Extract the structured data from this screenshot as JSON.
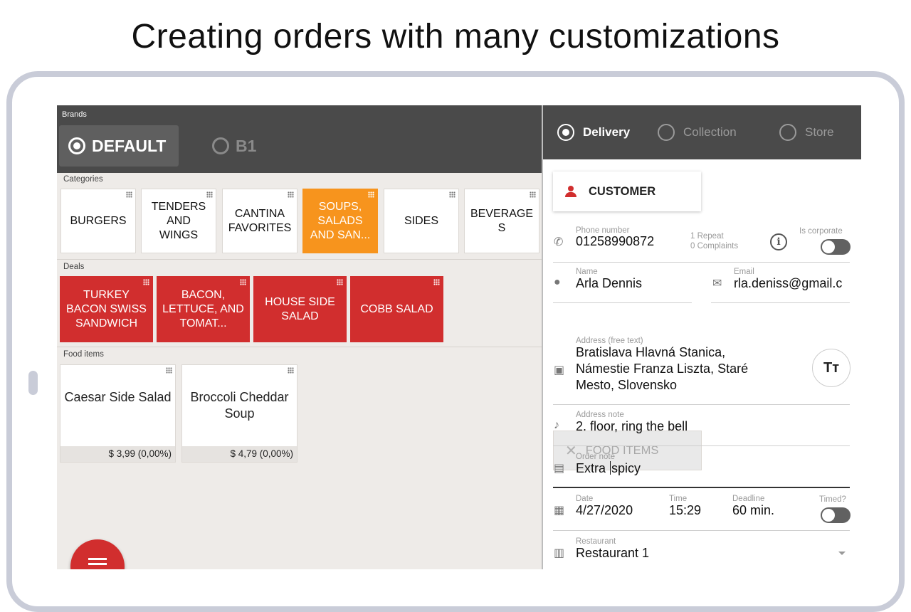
{
  "headline": "Creating orders with many customizations",
  "brands": {
    "label": "Brands",
    "items": [
      {
        "label": "DEFAULT",
        "selected": true
      },
      {
        "label": "B1",
        "selected": false
      }
    ]
  },
  "categories": {
    "label": "Categories",
    "items": [
      "BURGERS",
      "TENDERS AND WINGS",
      "CANTINA FAVORITES",
      "SOUPS, SALADS AND SAN...",
      "SIDES",
      "BEVERAGE S"
    ],
    "selected_index": 3
  },
  "deals": {
    "label": "Deals",
    "items": [
      "TURKEY BACON SWISS SANDWICH",
      "BACON, LETTUCE, AND TOMAT...",
      "HOUSE SIDE SALAD",
      "COBB SALAD"
    ]
  },
  "food_items": {
    "label": "Food items",
    "items": [
      {
        "name": "Caesar Side Salad",
        "price": "$ 3,99 (0,00%)"
      },
      {
        "name": "Broccoli Cheddar Soup",
        "price": "$ 4,79 (0,00%)"
      }
    ]
  },
  "delivery_types": [
    {
      "label": "Delivery",
      "selected": true
    },
    {
      "label": "Collection",
      "selected": false
    },
    {
      "label": "Store",
      "selected": false
    }
  ],
  "tabs": {
    "customer": "CUSTOMER",
    "food_items": "FOOD ITEMS"
  },
  "form": {
    "phone": {
      "label": "Phone number",
      "value": "01258990872"
    },
    "repeat": "1 Repeat",
    "complaints": "0 Complaints",
    "corporate": {
      "label": "Is corporate",
      "on": false
    },
    "name": {
      "label": "Name",
      "value": "Arla Dennis"
    },
    "email": {
      "label": "Email",
      "value": "rla.deniss@gmail.c"
    },
    "address": {
      "label": "Address (free text)",
      "line1": "Bratislava Hlavná Stanica,",
      "line2": "Námestie Franza Liszta, Staré",
      "line3": "Mesto, Slovensko"
    },
    "text_format_button": "Tт",
    "address_note": {
      "label": "Address note",
      "value": "2. floor, ring the bell"
    },
    "order_note": {
      "label": "Order note",
      "value_before_cursor": "Extra ",
      "value_after_cursor": "spicy"
    },
    "date": {
      "label": "Date",
      "value": "4/27/2020"
    },
    "time": {
      "label": "Time",
      "value": "15:29"
    },
    "deadline": {
      "label": "Deadline",
      "value": "60 min."
    },
    "timed": {
      "label": "Timed?",
      "on": false
    },
    "restaurant": {
      "label": "Restaurant",
      "value": "Restaurant 1"
    }
  },
  "colors": {
    "accent_red": "#d12e2e",
    "accent_orange": "#f7941d",
    "header_dark": "#4a4a4a"
  },
  "icons": [
    "phone-icon",
    "person-icon",
    "mail-icon",
    "address-icon",
    "bell-icon",
    "comment-icon",
    "calendar-icon",
    "store-icon",
    "info-icon",
    "fork-knife-icon",
    "grid-icon",
    "order-list-icon"
  ]
}
